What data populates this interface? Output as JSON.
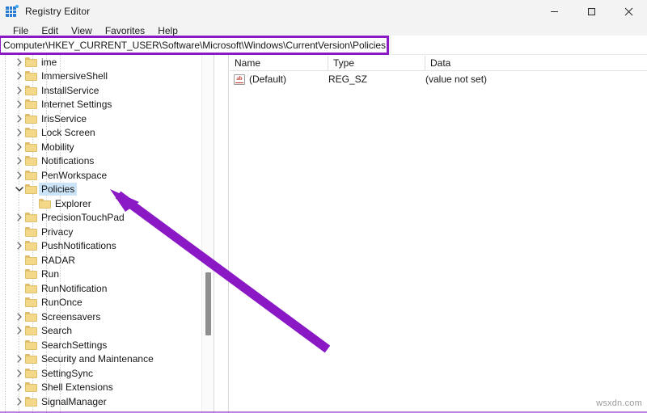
{
  "window": {
    "title": "Registry Editor",
    "icon": "registry-icon",
    "controls": {
      "minimize": "minimize-icon",
      "maximize": "maximize-icon",
      "close": "close-icon"
    }
  },
  "menu": {
    "items": [
      {
        "label": "File"
      },
      {
        "label": "Edit"
      },
      {
        "label": "View"
      },
      {
        "label": "Favorites"
      },
      {
        "label": "Help"
      }
    ]
  },
  "address": {
    "value": "Computer\\HKEY_CURRENT_USER\\Software\\Microsoft\\Windows\\CurrentVersion\\Policies",
    "placeholder": "Computer\\",
    "highlight_color": "#8a18c4"
  },
  "tree": {
    "nodes": [
      {
        "label": "ime",
        "indent": 1,
        "expander": "collapsed",
        "selected": false
      },
      {
        "label": "ImmersiveShell",
        "indent": 1,
        "expander": "collapsed",
        "selected": false
      },
      {
        "label": "InstallService",
        "indent": 1,
        "expander": "collapsed",
        "selected": false
      },
      {
        "label": "Internet Settings",
        "indent": 1,
        "expander": "collapsed",
        "selected": false
      },
      {
        "label": "IrisService",
        "indent": 1,
        "expander": "collapsed",
        "selected": false
      },
      {
        "label": "Lock Screen",
        "indent": 1,
        "expander": "collapsed",
        "selected": false
      },
      {
        "label": "Mobility",
        "indent": 1,
        "expander": "collapsed",
        "selected": false
      },
      {
        "label": "Notifications",
        "indent": 1,
        "expander": "collapsed",
        "selected": false
      },
      {
        "label": "PenWorkspace",
        "indent": 1,
        "expander": "collapsed",
        "selected": false
      },
      {
        "label": "Policies",
        "indent": 1,
        "expander": "expanded",
        "selected": true
      },
      {
        "label": "Explorer",
        "indent": 2,
        "expander": "none",
        "selected": false
      },
      {
        "label": "PrecisionTouchPad",
        "indent": 1,
        "expander": "collapsed",
        "selected": false
      },
      {
        "label": "Privacy",
        "indent": 1,
        "expander": "none",
        "selected": false
      },
      {
        "label": "PushNotifications",
        "indent": 1,
        "expander": "collapsed",
        "selected": false
      },
      {
        "label": "RADAR",
        "indent": 1,
        "expander": "none",
        "selected": false
      },
      {
        "label": "Run",
        "indent": 1,
        "expander": "none",
        "selected": false
      },
      {
        "label": "RunNotification",
        "indent": 1,
        "expander": "none",
        "selected": false
      },
      {
        "label": "RunOnce",
        "indent": 1,
        "expander": "none",
        "selected": false
      },
      {
        "label": "Screensavers",
        "indent": 1,
        "expander": "collapsed",
        "selected": false
      },
      {
        "label": "Search",
        "indent": 1,
        "expander": "collapsed",
        "selected": false
      },
      {
        "label": "SearchSettings",
        "indent": 1,
        "expander": "none",
        "selected": false
      },
      {
        "label": "Security and Maintenance",
        "indent": 1,
        "expander": "collapsed",
        "selected": false
      },
      {
        "label": "SettingSync",
        "indent": 1,
        "expander": "collapsed",
        "selected": false
      },
      {
        "label": "Shell Extensions",
        "indent": 1,
        "expander": "collapsed",
        "selected": false
      },
      {
        "label": "SignalManager",
        "indent": 1,
        "expander": "collapsed",
        "selected": false
      }
    ]
  },
  "list": {
    "columns": [
      {
        "label": "Name"
      },
      {
        "label": "Type"
      },
      {
        "label": "Data"
      }
    ],
    "rows": [
      {
        "icon": "string-value-icon",
        "name": "(Default)",
        "type": "REG_SZ",
        "data": "(value not set)"
      }
    ]
  },
  "annotation": {
    "arrow_color": "#8a18c4",
    "points_to": "Policies"
  },
  "watermark": {
    "text": "wsxdn.com"
  }
}
